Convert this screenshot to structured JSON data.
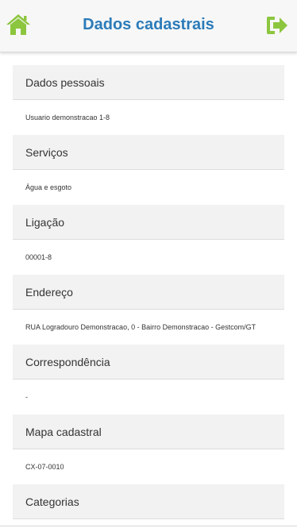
{
  "header": {
    "title": "Dados cadastrais",
    "accent_color": "#2b7bb9",
    "icon_color": "#8cc63f",
    "home_icon": "home-icon",
    "exit_icon": "sign-out-icon"
  },
  "sections": [
    {
      "label": "Dados pessoais",
      "value": "Usuario demonstracao 1-8"
    },
    {
      "label": "Serviços",
      "value": "Água e esgoto"
    },
    {
      "label": "Ligação",
      "value": "00001-8"
    },
    {
      "label": "Endereço",
      "value": "RUA Logradouro Demonstracao, 0 - Bairro Demonstracao - Gestcom/GT"
    },
    {
      "label": "Correspondência",
      "value": "-"
    },
    {
      "label": "Mapa cadastral",
      "value": "CX-07-0010"
    },
    {
      "label": "Categorias"
    }
  ]
}
